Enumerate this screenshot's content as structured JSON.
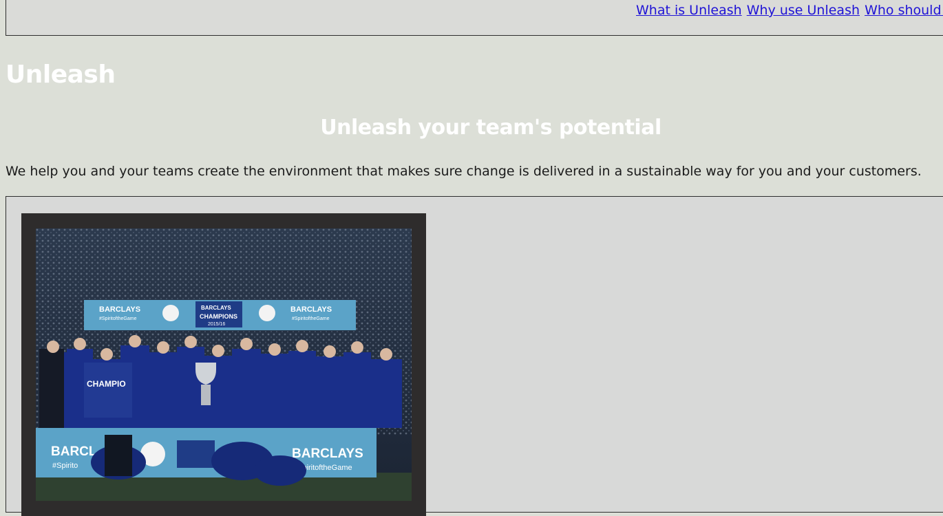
{
  "nav": {
    "links": [
      "What is Unleash",
      "Why use Unleash",
      "Who should use"
    ]
  },
  "brand": "Unleash",
  "tagline": "Unleash your team's potential",
  "intro": "We help you and your teams create the environment that makes sure change is delivered in a sustainable way for you and your customers.",
  "photo": {
    "banner_top_left": "BARCLAYS",
    "banner_top_left_sub": "#SpiritoftheGame",
    "banner_center_top": "BARCLAYS",
    "banner_center_main": "CHAMPIONS",
    "banner_center_sub": "2015/16",
    "banner_top_right": "BARCLAYS",
    "banner_top_right_sub": "#SpiritoftheGame",
    "banner_bottom_left": "BARCL",
    "banner_bottom_left_sub": "#Spirito",
    "banner_bottom_right": "BARCLAYS",
    "banner_bottom_right_sub": "#SpiritoftheGame",
    "scarf": "CHAMPIO"
  },
  "colors": {
    "page_bg": "#dcdfd7",
    "link": "#1f13d6",
    "banner": "#5ba3c8",
    "kit": "#1a2f8a"
  }
}
